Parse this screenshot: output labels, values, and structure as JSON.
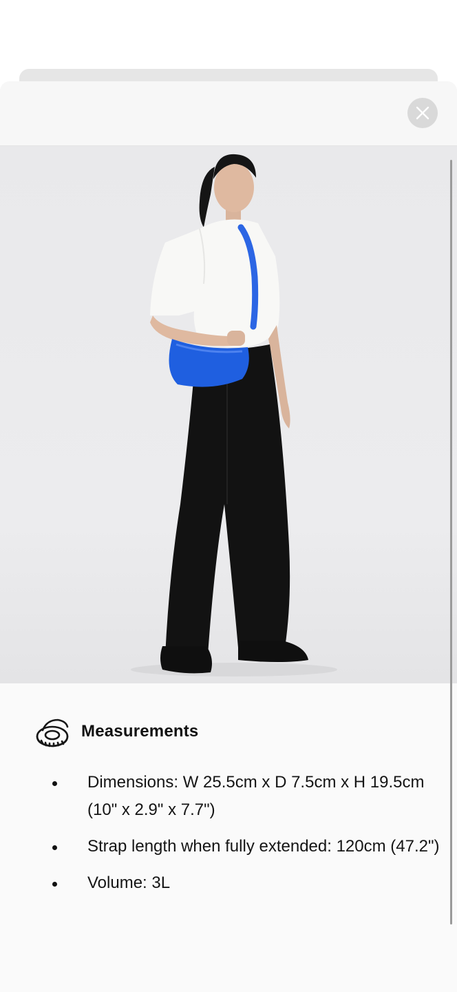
{
  "close": {
    "label": "Close"
  },
  "product_image": {
    "alt": ""
  },
  "measurements": {
    "icon": "measuring-tape-icon",
    "title": "Measurements",
    "items": [
      "Dimensions: W 25.5cm x D 7.5cm x H 19.5cm (10\" x 2.9\" x 7.7\")",
      "Strap length when fully extended: 120cm (47.2\")",
      "Volume: 3L"
    ]
  },
  "colors": {
    "bag": "#1f5fe0",
    "shirt": "#f8f8f6",
    "pants": "#121212",
    "background": "#ebebed"
  }
}
